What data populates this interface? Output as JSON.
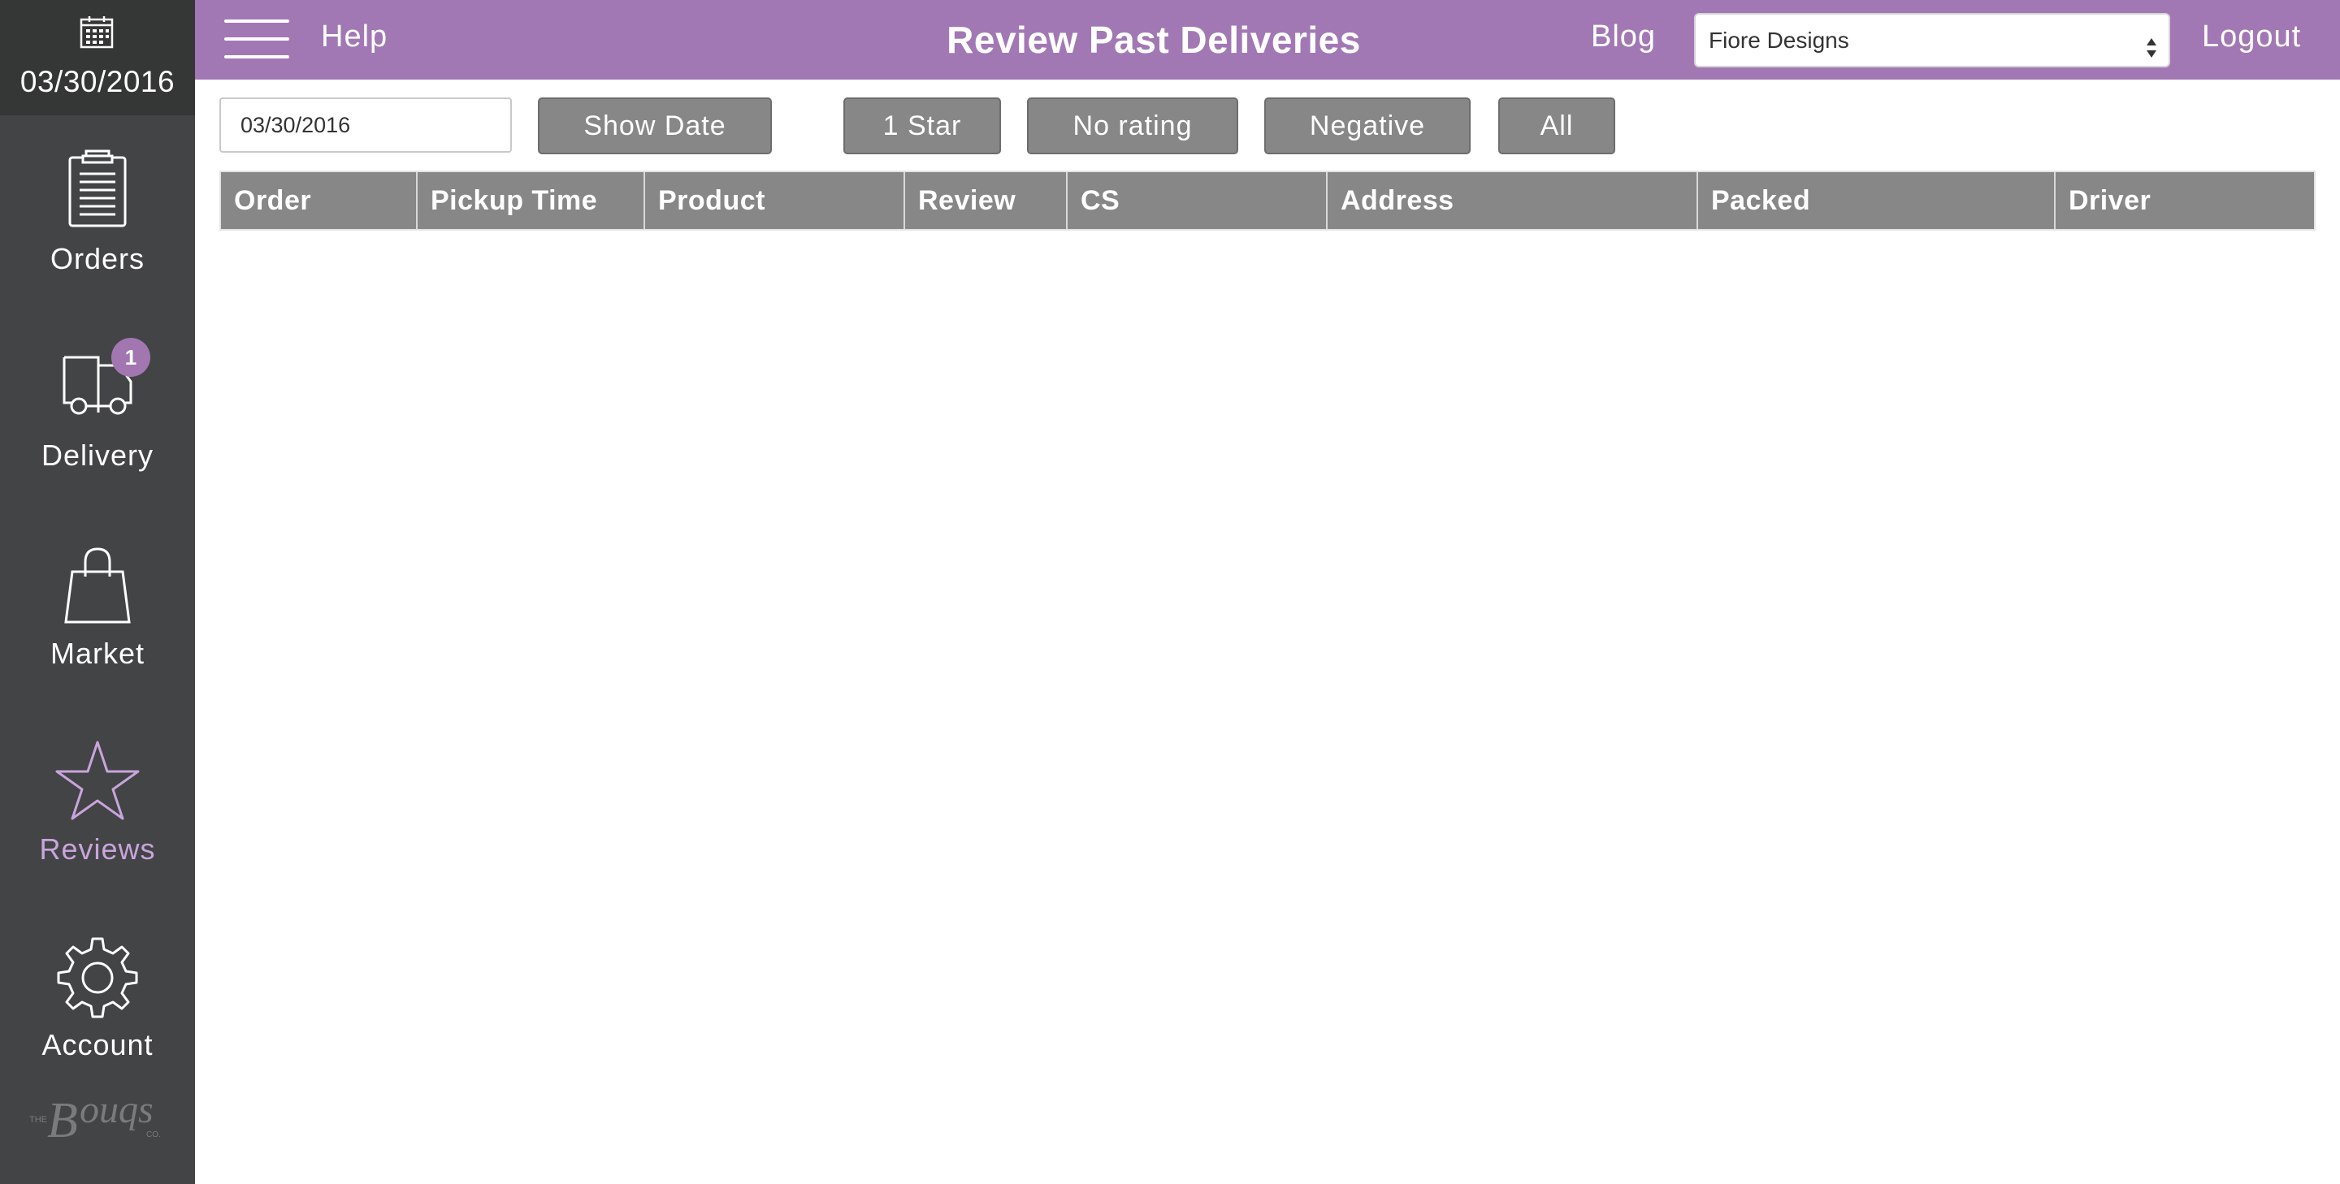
{
  "sidebar": {
    "date": "03/30/2016",
    "calendar_icon": "calendar-icon",
    "items": [
      {
        "label": "Orders",
        "icon": "clipboard-icon",
        "active": false
      },
      {
        "label": "Delivery",
        "icon": "truck-icon",
        "active": false,
        "badge": "1"
      },
      {
        "label": "Market",
        "icon": "shopping-bag-icon",
        "active": false
      },
      {
        "label": "Reviews",
        "icon": "star-icon",
        "active": true
      },
      {
        "label": "Account",
        "icon": "gear-icon",
        "active": false
      }
    ],
    "brand_logo": "The Bouqs Co."
  },
  "topbar": {
    "menu_icon": "hamburger-icon",
    "help_label": "Help",
    "title": "Review Past Deliveries",
    "blog_label": "Blog",
    "store_select_value": "Fiore Designs",
    "logout_label": "Logout"
  },
  "filters": {
    "date_value": "03/30/2016",
    "show_date_label": "Show Date",
    "one_star_label": "1 Star",
    "no_rating_label": "No rating",
    "negative_label": "Negative",
    "all_label": "All"
  },
  "table": {
    "columns": [
      "Order",
      "Pickup Time",
      "Product",
      "Review",
      "CS",
      "Address",
      "Packed",
      "Driver"
    ],
    "rows": []
  },
  "colors": {
    "accent": "#a278b4",
    "sidebar_bg": "#434445",
    "sidebar_date_bg": "#353636",
    "active_nav": "#c9a4dd",
    "button_gray": "#878787"
  }
}
